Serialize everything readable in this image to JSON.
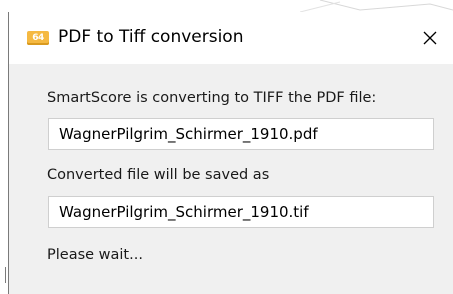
{
  "window": {
    "title": "PDF to Tiff conversion",
    "icon": "app-logo-icon",
    "icon_text": "64",
    "close_icon": "close-icon"
  },
  "dialog": {
    "message": "SmartScore is converting to TIFF the PDF file:",
    "source_file": "WagnerPilgrim_Schirmer_1910.pdf",
    "output_label": "Converted file will be saved as",
    "output_file": "WagnerPilgrim_Schirmer_1910.tif",
    "status": "Please wait..."
  },
  "colors": {
    "titlebar": "#ffffff",
    "body": "#f0f0f0",
    "field_border": "#cfcfcf",
    "icon_accent": "#f5b942"
  }
}
